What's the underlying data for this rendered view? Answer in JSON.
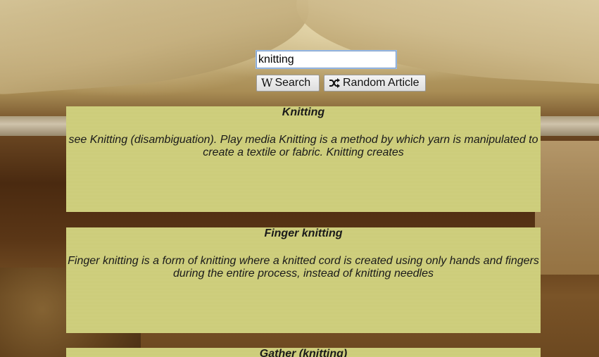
{
  "search": {
    "value": "knitting",
    "search_button_label": "Search",
    "search_button_icon": "wikipedia-w-icon",
    "search_button_icon_glyph": "W",
    "random_button_label": "Random Article",
    "random_button_icon": "shuffle-icon"
  },
  "results": [
    {
      "title": "Knitting",
      "snippet": "see Knitting (disambiguation). Play media Knitting is a method by which yarn is manipulated to create a textile or fabric. Knitting creates"
    },
    {
      "title": "Finger knitting",
      "snippet": "Finger knitting is a form of knitting where a knitted cord is created using only hands and fingers during the entire process, instead of knitting needles"
    },
    {
      "title": "Gather (knitting)",
      "snippet": ""
    }
  ],
  "colors": {
    "card_background": "#cfcf7a",
    "input_border": "#7a9cc9"
  }
}
